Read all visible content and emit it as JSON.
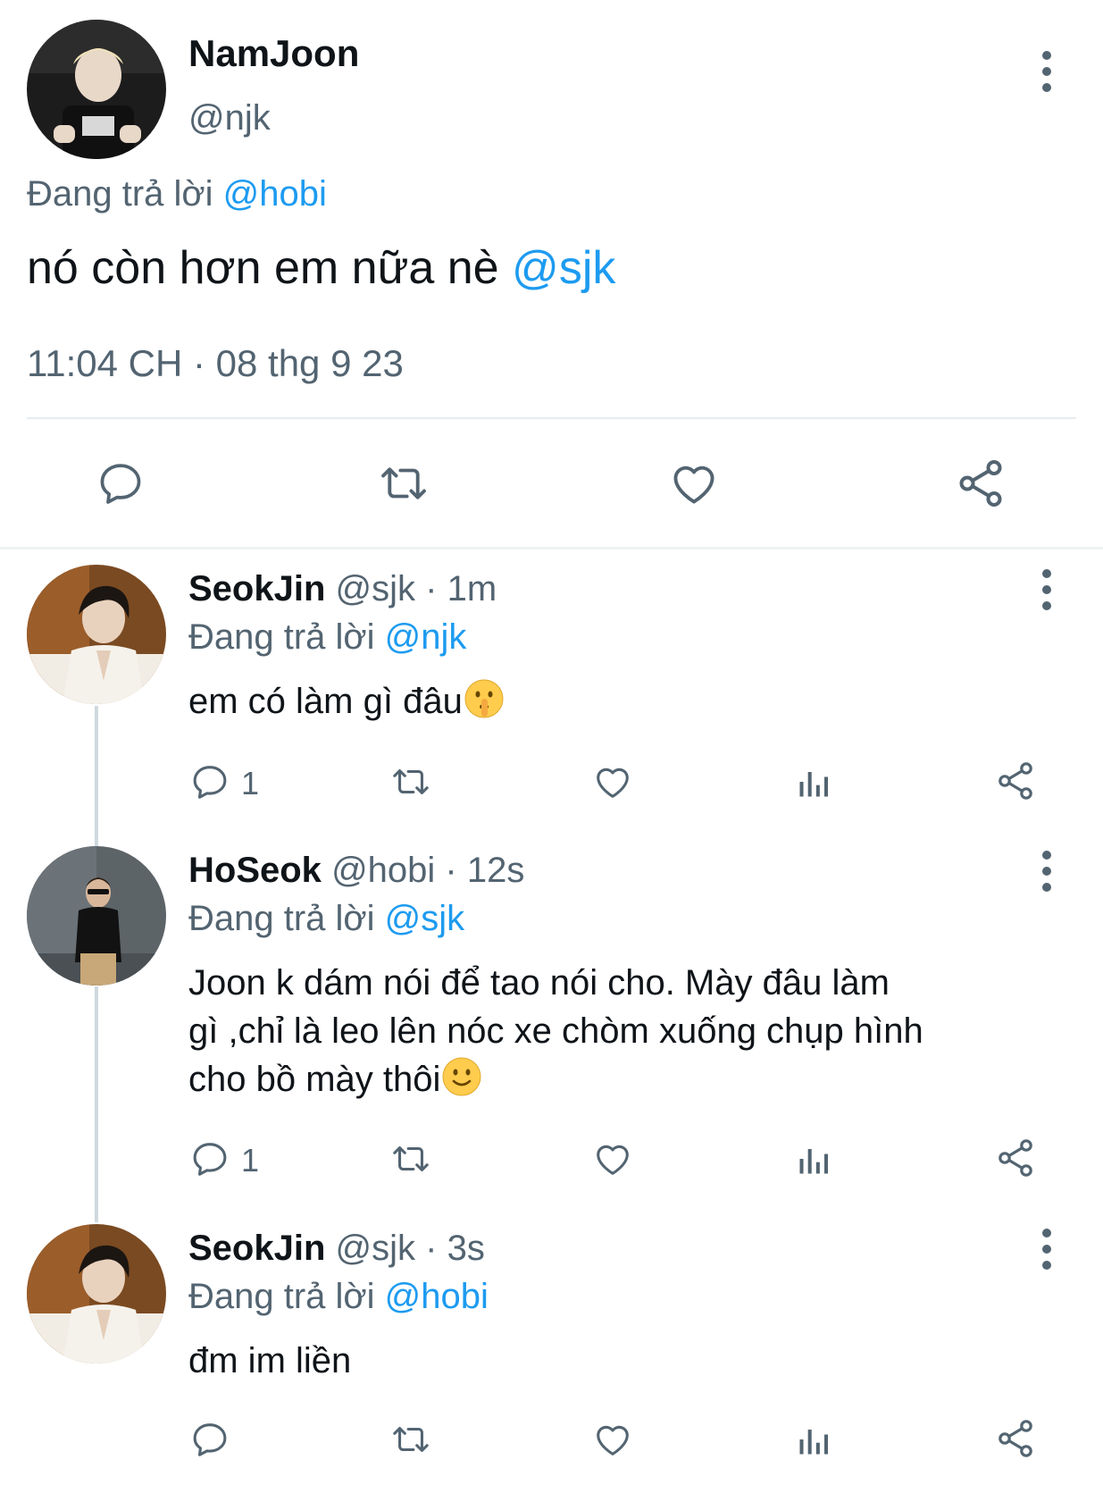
{
  "main_tweet": {
    "display_name": "NamJoon",
    "handle": "@njk",
    "reply_prefix": "Đang trả lời",
    "reply_to": "@hobi",
    "text": "nó còn hơn em nữa nè",
    "text_mention": "@sjk",
    "timestamp": "11:04 CH · 08 thg 9 23",
    "actions": [
      "reply-icon",
      "retweet-icon",
      "like-icon",
      "share-icon"
    ]
  },
  "replies": [
    {
      "display_name": "SeokJin",
      "meta": "@sjk · 1m",
      "reply_prefix": "Đang trả lời",
      "reply_to": "@njk",
      "text": "em có làm gì đâu",
      "emoji": "shushing-face-emoji",
      "reply_count": "1"
    },
    {
      "display_name": "HoSeok",
      "meta": "@hobi · 12s",
      "reply_prefix": "Đang trả lời",
      "reply_to": "@sjk",
      "text_line1": "Joon k dám nói để tao nói cho. Mày đâu làm",
      "text_line2": "gì ,chỉ là leo lên nóc xe chòm xuống chụp hình",
      "text_line3": "cho bồ mày thôi",
      "emoji": "slightly-smiling-face-emoji",
      "reply_count": "1"
    },
    {
      "display_name": "SeokJin",
      "meta": "@sjk · 3s",
      "reply_prefix": "Đang trả lời",
      "reply_to": "@hobi",
      "text": "đm im liền",
      "reply_count": ""
    }
  ],
  "colors": {
    "accent": "#1d9bf0",
    "secondary_text": "#536471",
    "primary_text": "#0f1419",
    "divider": "#eff3f4"
  }
}
